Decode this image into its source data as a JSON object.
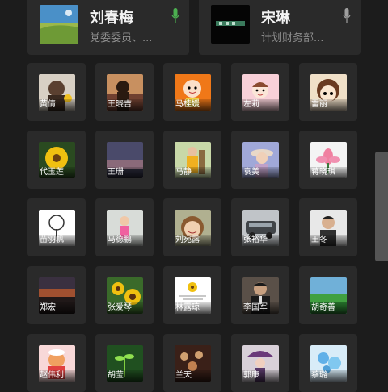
{
  "top_contacts": [
    {
      "name": "刘春梅",
      "role": "党委委员、...",
      "mic_color": "#4caf50"
    },
    {
      "name": "宋琳",
      "role": "计划财务部...",
      "mic_color": "#9e9e9e"
    }
  ],
  "grid": [
    [
      {
        "name": "黄倩",
        "icon": "girl-silhouette-photo"
      },
      {
        "name": "王晓吉",
        "icon": "girl-sunset-photo"
      },
      {
        "name": "马桂媛",
        "icon": "cartoon-girl-avatar"
      },
      {
        "name": "左莉",
        "icon": "cartoon-face-avatar"
      },
      {
        "name": "雷丽",
        "icon": "cartoon-doll-avatar"
      }
    ],
    [
      {
        "name": "代玉莲",
        "icon": "sunflower-photo"
      },
      {
        "name": "王珊",
        "icon": "dusk-sky-photo"
      },
      {
        "name": "马静",
        "icon": "woman-yellow-photo"
      },
      {
        "name": "袁美",
        "icon": "woman-hat-photo"
      },
      {
        "name": "蒋晓琪",
        "icon": "lotus-flower-photo"
      }
    ],
    [
      {
        "name": "苗羽帆",
        "icon": "tree-drawing-avatar"
      },
      {
        "name": "马德鹏",
        "icon": "child-pink-photo"
      },
      {
        "name": "刘宛露",
        "icon": "smiling-girl-photo"
      },
      {
        "name": "张裕华",
        "icon": "car-street-photo"
      },
      {
        "name": "王冬",
        "icon": "man-portrait-photo"
      }
    ],
    [
      {
        "name": "郑宏",
        "icon": "evening-scene-photo"
      },
      {
        "name": "张爱琴",
        "icon": "sunflowers-photo"
      },
      {
        "name": "林露琼",
        "icon": "sunflower-card-avatar"
      },
      {
        "name": "李国军",
        "icon": "man-suit-photo"
      },
      {
        "name": "胡奇善",
        "icon": "green-landscape-photo"
      }
    ],
    [
      {
        "name": "赵伟利",
        "icon": "cartoon-chef-avatar"
      },
      {
        "name": "胡莹",
        "icon": "sprout-photo"
      },
      {
        "name": "兰天",
        "icon": "tea-cups-photo"
      },
      {
        "name": "郭康",
        "icon": "umbrella-girl-photo"
      },
      {
        "name": "蔡璐",
        "icon": "blue-flowers-photo"
      }
    ]
  ]
}
